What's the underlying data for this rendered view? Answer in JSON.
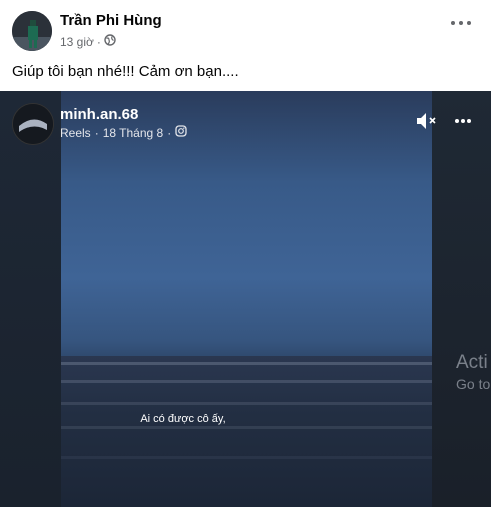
{
  "post": {
    "author": "Trần Phi Hùng",
    "time": "13 giờ",
    "audience_icon": "globe-icon",
    "text": "Giúp tôi bạn nhé!!! Cảm ơn bạn...."
  },
  "reel": {
    "username": "minh.an.68",
    "meta_prefix": "Reels",
    "separator": "·",
    "date": "18 Tháng 8",
    "caption": "Ai có được cô ấy,"
  },
  "watermark": {
    "title": "Acti",
    "subtitle": "Go to"
  }
}
